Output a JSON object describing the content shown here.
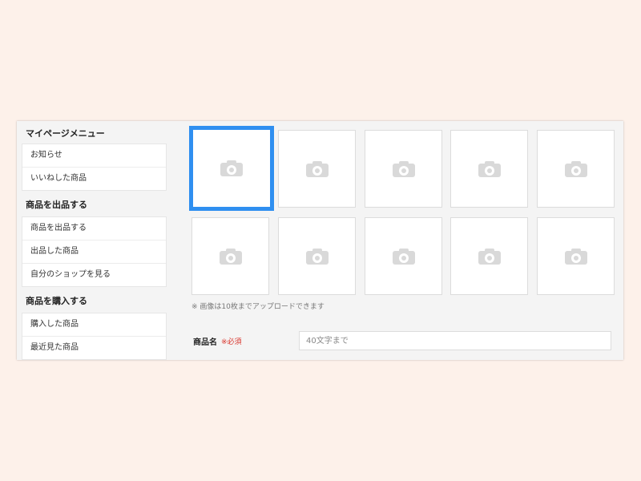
{
  "sidebar": {
    "sections": [
      {
        "title": "マイページメニュー",
        "items": [
          "お知らせ",
          "いいねした商品"
        ]
      },
      {
        "title": "商品を出品する",
        "items": [
          "商品を出品する",
          "出品した商品",
          "自分のショップを見る"
        ]
      },
      {
        "title": "商品を購入する",
        "items": [
          "購入した商品",
          "最近見た商品"
        ]
      }
    ]
  },
  "upload": {
    "slot_icon": "camera-icon",
    "slot_count": 10,
    "note": "※ 画像は10枚までアップロードできます"
  },
  "form": {
    "product_name": {
      "label": "商品名",
      "required": "※必須",
      "placeholder": "40文字まで",
      "value": ""
    }
  },
  "colors": {
    "background": "#fdf1ea",
    "panel": "#f4f4f4",
    "selected_border": "#2f8ff0",
    "required_text": "#d9342b"
  }
}
